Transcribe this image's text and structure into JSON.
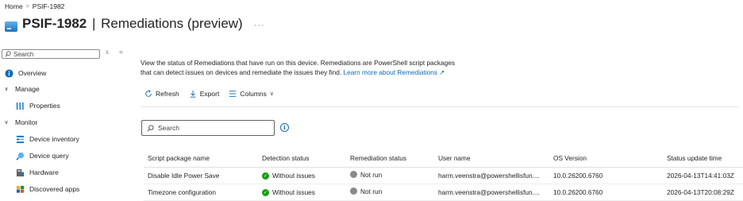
{
  "breadcrumb": {
    "home": "Home",
    "sep": ">",
    "current": "PSIF-1982"
  },
  "title": {
    "device": "PSIF-1982",
    "pipe": "|",
    "section": "Remediations (preview)",
    "more": "···"
  },
  "sidebar": {
    "search_placeholder": "Search",
    "close_glyph": "x",
    "collapse_glyph": "«",
    "items": [
      {
        "label": "Overview",
        "icon": "info-icon"
      },
      {
        "label": "Manage",
        "icon": "chevron-down-icon"
      },
      {
        "label": "Properties",
        "icon": "properties-icon"
      },
      {
        "label": "Monitor",
        "icon": "chevron-down-icon"
      },
      {
        "label": "Device inventory",
        "icon": "device-inventory-icon"
      },
      {
        "label": "Device query",
        "icon": "device-query-icon"
      },
      {
        "label": "Hardware",
        "icon": "hardware-icon"
      },
      {
        "label": "Discovered apps",
        "icon": "apps-icon"
      }
    ]
  },
  "main": {
    "description_line1": "View the status of Remediations that have run on this device. Remediations are PowerShell script packages",
    "description_line2": "that can detect issues on devices and remediate the issues they find.",
    "learn_more": "Learn more about Remediations",
    "toolbar": {
      "refresh": "Refresh",
      "export": "Export",
      "columns": "Columns"
    },
    "search_placeholder": "Search",
    "columns": [
      "Script package name",
      "Detection status",
      "Remediation status",
      "User name",
      "OS Version",
      "Status update time"
    ],
    "rows": [
      {
        "name": "Disable Idle Power Save",
        "detection": "Without issues",
        "remediation": "Not run",
        "user": "harm.veenstra@powershellisfun....",
        "os": "10.0.26200.6760",
        "time": "2026-04-13T14:41:03Z"
      },
      {
        "name": "Timezone configuration",
        "detection": "Without issues",
        "remediation": "Not run",
        "user": "harm.veenstra@powershellisfun....",
        "os": "10.0.26200.6760",
        "time": "2026-04-13T20:08:29Z"
      }
    ]
  },
  "colors": {
    "accent": "#0f6cbd",
    "success": "#13a10e",
    "neutral": "#8a8a8a"
  }
}
